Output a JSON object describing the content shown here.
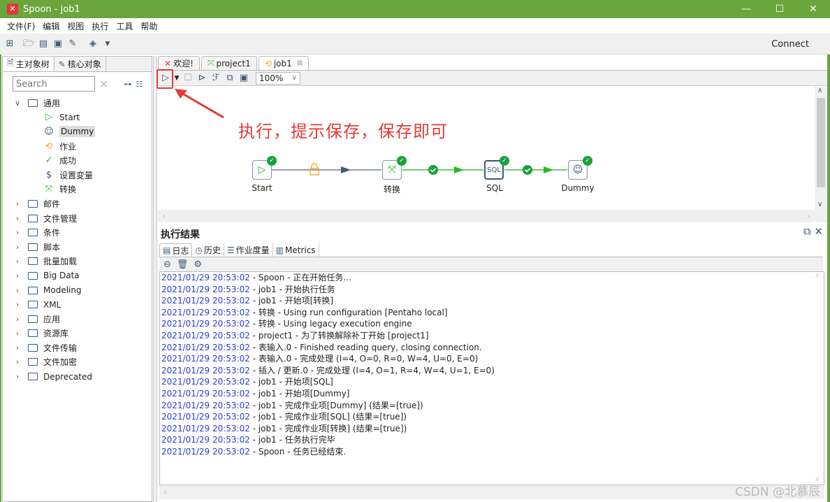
{
  "window": {
    "title": "Spoon - job1",
    "app_icon": "spoon-logo-icon",
    "controls": [
      "minimize",
      "maximize",
      "close"
    ]
  },
  "menu": [
    "文件(F)",
    "编辑",
    "视图",
    "执行",
    "工具",
    "帮助"
  ],
  "toolbar": {
    "icons": [
      "new-file-icon",
      "open-file-icon",
      "explore-repository-icon",
      "save-icon",
      "save-as-icon",
      "perspective-layers-icon"
    ],
    "connect_label": "Connect"
  },
  "left_panel": {
    "tabs": [
      {
        "label": "主对象树",
        "icon": "tree-icon"
      },
      {
        "label": "核心对象",
        "icon": "pencil-icon"
      }
    ],
    "search_placeholder": "Search",
    "tree": [
      {
        "label": "通用",
        "expanded": true,
        "children": [
          {
            "label": "Start",
            "icon": "start-icon"
          },
          {
            "label": "Dummy",
            "icon": "dummy-icon",
            "selected": true
          },
          {
            "label": "作业",
            "icon": "job-icon"
          },
          {
            "label": "成功",
            "icon": "success-icon"
          },
          {
            "label": "设置变量",
            "icon": "set-variables-icon"
          },
          {
            "label": "转换",
            "icon": "transformation-icon"
          }
        ]
      },
      {
        "label": "邮件"
      },
      {
        "label": "文件管理"
      },
      {
        "label": "条件"
      },
      {
        "label": "脚本"
      },
      {
        "label": "批量加载"
      },
      {
        "label": "Big Data"
      },
      {
        "label": "Modeling"
      },
      {
        "label": "XML"
      },
      {
        "label": "应用"
      },
      {
        "label": "资源库"
      },
      {
        "label": "文件传输"
      },
      {
        "label": "文件加密"
      },
      {
        "label": "Deprecated"
      }
    ]
  },
  "editor": {
    "tabs": [
      {
        "label": "欢迎!",
        "active": false
      },
      {
        "label": "project1",
        "active": false
      },
      {
        "label": "job1",
        "active": true,
        "closable": true
      }
    ],
    "zoom": "100%",
    "annotation": "执行，提示保存，保存即可",
    "nodes": [
      {
        "label": "Start",
        "status": "ok"
      },
      {
        "label": "转换",
        "status": "ok"
      },
      {
        "label": "SQL",
        "status": "ok",
        "selected": true
      },
      {
        "label": "Dummy",
        "status": "ok"
      }
    ],
    "hops": [
      {
        "from": "Start",
        "to": "转换",
        "type": "unconditional",
        "locked": true
      },
      {
        "from": "转换",
        "to": "SQL",
        "type": "success"
      },
      {
        "from": "SQL",
        "to": "Dummy",
        "type": "success"
      }
    ]
  },
  "results": {
    "title": "执行结果",
    "tabs": [
      {
        "label": "日志",
        "active": true
      },
      {
        "label": "历史"
      },
      {
        "label": "作业度量"
      },
      {
        "label": "Metrics"
      }
    ],
    "log": [
      {
        "ts": "2021/01/29 20:53:02",
        "msg": " - Spoon - 正在开始任务..."
      },
      {
        "ts": "2021/01/29 20:53:02",
        "msg": " - job1 - 开始执行任务"
      },
      {
        "ts": "2021/01/29 20:53:02",
        "msg": " - job1 - 开始项[转换]"
      },
      {
        "ts": "2021/01/29 20:53:02",
        "msg": " - 转换 - Using run configuration [Pentaho local]"
      },
      {
        "ts": "2021/01/29 20:53:02",
        "msg": " - 转换 - Using legacy execution engine"
      },
      {
        "ts": "2021/01/29 20:53:02",
        "msg": " - project1 - 为了转换解除补丁开始  [project1]"
      },
      {
        "ts": "2021/01/29 20:53:02",
        "msg": " - 表输入.0 - Finished reading query, closing connection."
      },
      {
        "ts": "2021/01/29 20:53:02",
        "msg": " - 表输入.0 - 完成处理 (I=4, O=0, R=0, W=4, U=0, E=0)"
      },
      {
        "ts": "2021/01/29 20:53:02",
        "msg": " - 插入 / 更新.0 - 完成处理 (I=4, O=1, R=4, W=4, U=1, E=0)"
      },
      {
        "ts": "2021/01/29 20:53:02",
        "msg": " - job1 - 开始项[SQL]"
      },
      {
        "ts": "2021/01/29 20:53:02",
        "msg": " - job1 - 开始项[Dummy]"
      },
      {
        "ts": "2021/01/29 20:53:02",
        "msg": " - job1 - 完成作业项[Dummy] (结果=[true])"
      },
      {
        "ts": "2021/01/29 20:53:02",
        "msg": " - job1 - 完成作业项[SQL] (结果=[true])"
      },
      {
        "ts": "2021/01/29 20:53:02",
        "msg": " - job1 - 完成作业项[转换] (结果=[true])"
      },
      {
        "ts": "2021/01/29 20:53:02",
        "msg": " - job1 - 任务执行完毕"
      },
      {
        "ts": "2021/01/29 20:53:02",
        "msg": " - Spoon - 任务已经结束."
      }
    ]
  },
  "watermark": "CSDN @北慕辰",
  "colors": {
    "titlebar": "#6aa63b",
    "timestamp": "#2a3cdb",
    "annotation": "#e53935",
    "ok_badge": "#19a23a",
    "success_hop": "#3cc43c",
    "default_hop": "#5a6b7c"
  }
}
